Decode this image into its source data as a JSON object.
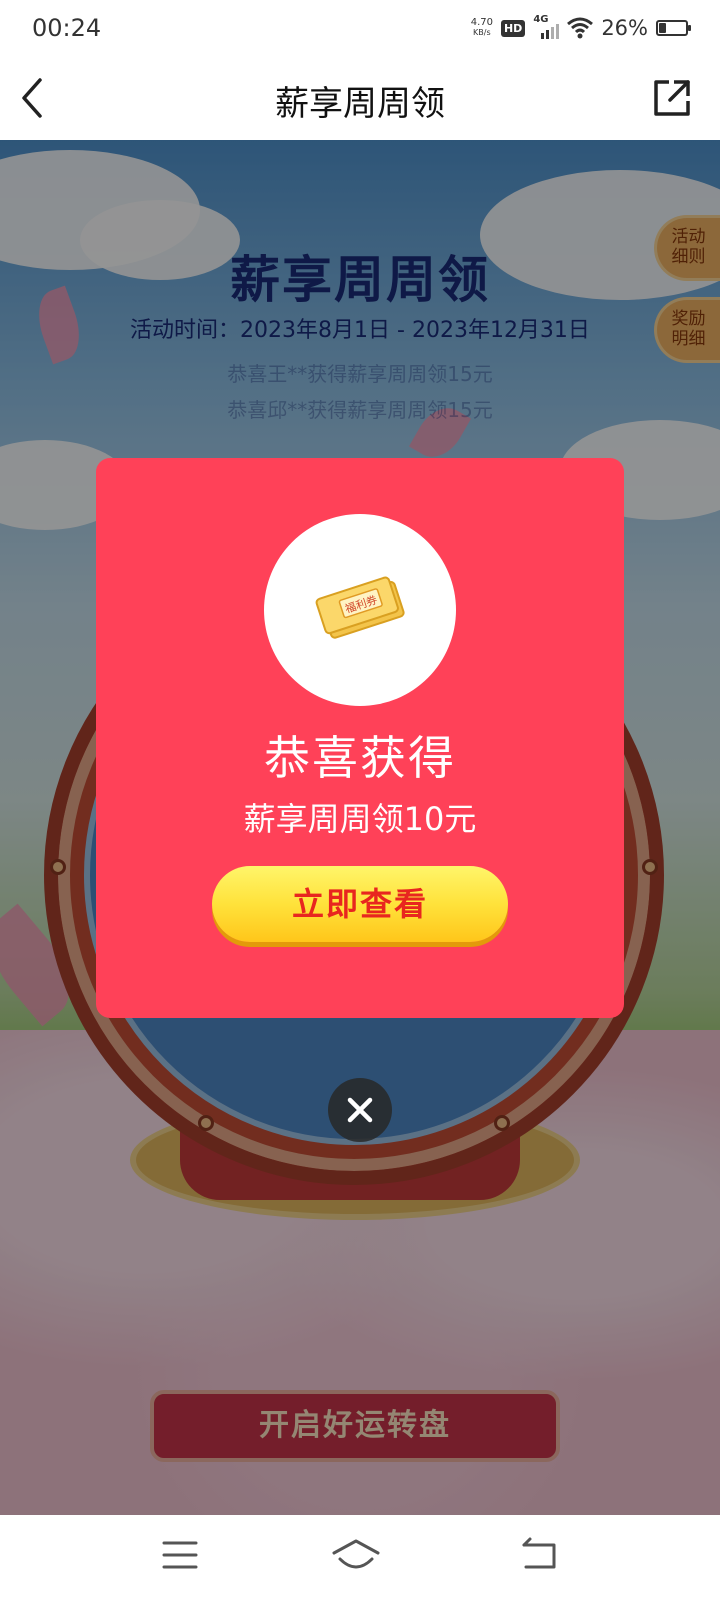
{
  "status_bar": {
    "time": "00:24",
    "net_speed_value": "4.70",
    "net_speed_unit": "KB/s",
    "hd_label": "HD",
    "network_type": "4G",
    "battery_percent_label": "26%",
    "battery_level": 0.26
  },
  "header": {
    "title": "薪享周周领",
    "back_icon": "chevron-left-icon",
    "share_icon": "share-external-icon"
  },
  "activity": {
    "title": "薪享周周领",
    "time_range": "活动时间：2023年8月1日 - 2023年12月31日",
    "ticker_lines": [
      "恭喜王**获得薪享周周领15元",
      "恭喜邱**获得薪享周周领15元"
    ],
    "side_buttons": [
      {
        "line1": "活动",
        "line2": "细则"
      },
      {
        "line1": "奖励",
        "line2": "明细"
      }
    ],
    "start_button": "开启好运转盘"
  },
  "modal": {
    "title": "恭喜获得",
    "prize": "薪享周周领10元",
    "action_button": "立即查看",
    "coupon_text": "福利券",
    "background_color": "#ff4158",
    "close_icon": "close-icon"
  },
  "nav_bar": {
    "menu_icon": "menu-icon",
    "home_icon": "home-icon",
    "back_icon": "back-icon"
  }
}
